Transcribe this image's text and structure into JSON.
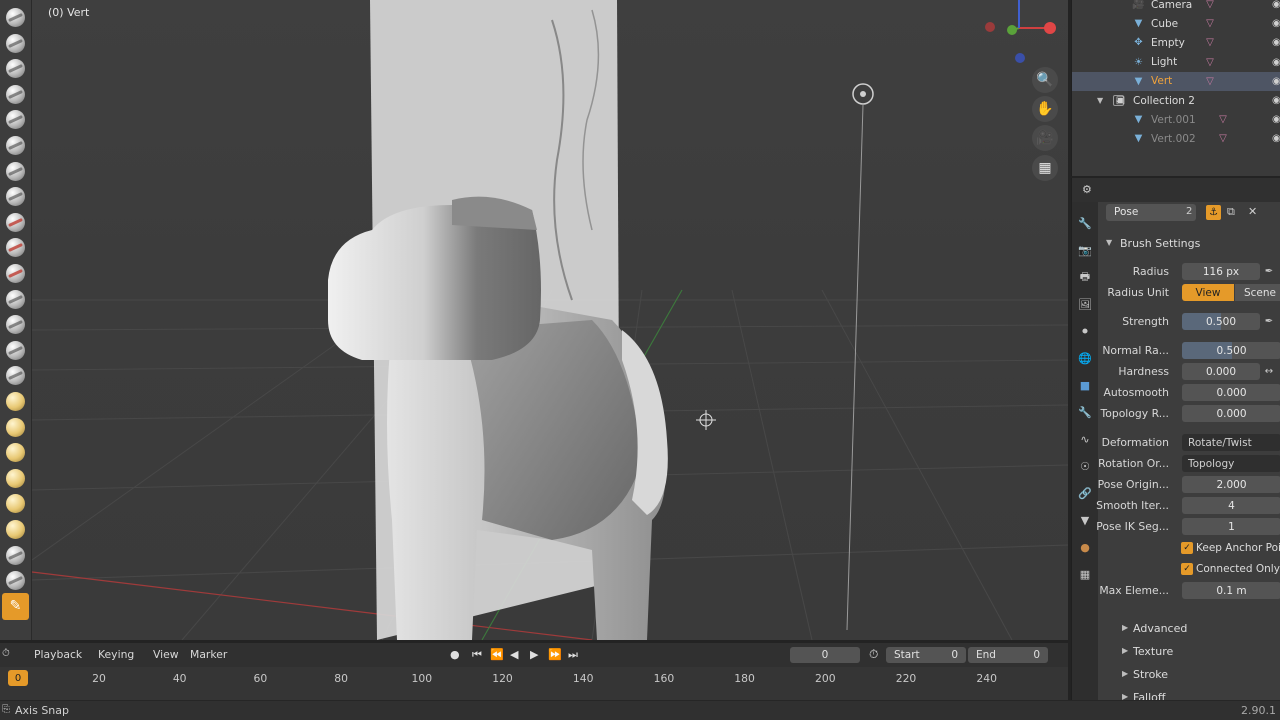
{
  "viewport": {
    "label": "(0) Vert",
    "nav_buttons": [
      "zoom-icon",
      "hand-icon",
      "camera-icon",
      "grid-icon"
    ]
  },
  "toolbar": {
    "tools": [
      "draw",
      "draw-sharp",
      "clay",
      "clay-strips",
      "clay-thumb",
      "layer",
      "inflate",
      "blob",
      "crease",
      "smooth",
      "flatten",
      "fill",
      "scrape",
      "multiplane-scrape",
      "pinch",
      "grab",
      "elastic-deform",
      "snake-hook",
      "thumb",
      "pose",
      "nudge",
      "rotate",
      "slide-relax",
      "annotate"
    ],
    "active_index": 23
  },
  "outliner": {
    "items": [
      {
        "name": "Camera",
        "type": "camera",
        "indent": 2
      },
      {
        "name": "Cube",
        "type": "mesh",
        "indent": 2
      },
      {
        "name": "Empty",
        "type": "empty",
        "indent": 2
      },
      {
        "name": "Light",
        "type": "light",
        "indent": 2
      },
      {
        "name": "Vert",
        "type": "mesh",
        "indent": 2,
        "selected": true
      },
      {
        "name": "Collection 2",
        "type": "collection",
        "indent": 1
      },
      {
        "name": "Vert.001",
        "type": "mesh",
        "indent": 2,
        "dim": true
      },
      {
        "name": "Vert.002",
        "type": "mesh",
        "indent": 2,
        "dim": true
      }
    ]
  },
  "properties": {
    "brush_name": "Pose",
    "brush_users": "2",
    "brush_settings_title": "Brush Settings",
    "radius": {
      "label": "Radius",
      "value": "116 px"
    },
    "radius_unit": {
      "label": "Radius Unit",
      "options": [
        "View",
        "Scene"
      ],
      "selected": "View"
    },
    "strength": {
      "label": "Strength",
      "value": "0.500",
      "fill": 0.5
    },
    "normal_radius": {
      "label": "Normal Ra...",
      "value": "0.500",
      "fill": 0.5
    },
    "hardness": {
      "label": "Hardness",
      "value": "0.000"
    },
    "autosmooth": {
      "label": "Autosmooth",
      "value": "0.000"
    },
    "topology_rake": {
      "label": "Topology R...",
      "value": "0.000"
    },
    "deformation": {
      "label": "Deformation",
      "value": "Rotate/Twist"
    },
    "rotation_origins": {
      "label": "Rotation Or...",
      "value": "Topology"
    },
    "pose_origin_offset": {
      "label": "Pose Origin...",
      "value": "2.000"
    },
    "smooth_iterations": {
      "label": "Smooth Iter...",
      "value": "4"
    },
    "pose_ik_segments": {
      "label": "Pose IK Seg...",
      "value": "1"
    },
    "keep_anchor_point": {
      "label": "Keep Anchor Point",
      "checked": true
    },
    "connected_only": {
      "label": "Connected Only",
      "checked": true
    },
    "max_element_distance": {
      "label": "Max Eleme...",
      "value": "0.1 m"
    },
    "panels": [
      "Advanced",
      "Texture",
      "Stroke",
      "Falloff"
    ]
  },
  "timeline": {
    "menus": [
      "Playback",
      "Keying",
      "View",
      "Marker"
    ],
    "current_frame": "0",
    "start_label": "Start",
    "start_value": "0",
    "end_label": "End",
    "end_value": "0",
    "playhead": "0",
    "ticks": [
      "20",
      "40",
      "60",
      "80",
      "100",
      "120",
      "140",
      "160",
      "180",
      "200",
      "220",
      "240"
    ]
  },
  "statusbar": {
    "left": "Axis Snap",
    "right": "2.90.1"
  },
  "colors": {
    "accent": "#e59a29",
    "selection": "#4e5564",
    "viewport_bg": "#3d3d3d"
  }
}
